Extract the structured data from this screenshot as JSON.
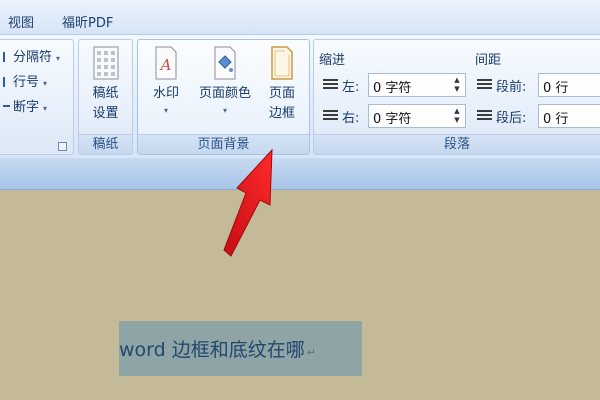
{
  "tabs": [
    {
      "label": "视图"
    },
    {
      "label": "福昕PDF"
    }
  ],
  "page_setup_group": {
    "breaks_label": "分隔符",
    "line_numbers_label": "行号",
    "hyphenation_label": "断字"
  },
  "manuscript_group": {
    "button_line1": "稿纸",
    "button_line2": "设置",
    "label": "稿纸"
  },
  "page_background_group": {
    "label": "页面背景",
    "watermark": {
      "label": "水印"
    },
    "page_color": {
      "label": "页面颜色"
    },
    "page_borders": {
      "line1": "页面",
      "line2": "边框"
    }
  },
  "paragraph_group": {
    "label": "段落",
    "indent": {
      "title": "缩进",
      "left_label": "左:",
      "left_value": "0 字符",
      "right_label": "右:",
      "right_value": "0 字符"
    },
    "spacing": {
      "title": "间距",
      "before_label": "段前:",
      "before_value": "0 行",
      "after_label": "段后:",
      "after_value": "0 行"
    }
  },
  "document": {
    "selected_text": "word 边框和底纹在哪"
  },
  "colors": {
    "annotation_arrow": "#e8111a",
    "document_background": "#c4ba98",
    "selection_highlight": "#8fa4a4"
  }
}
